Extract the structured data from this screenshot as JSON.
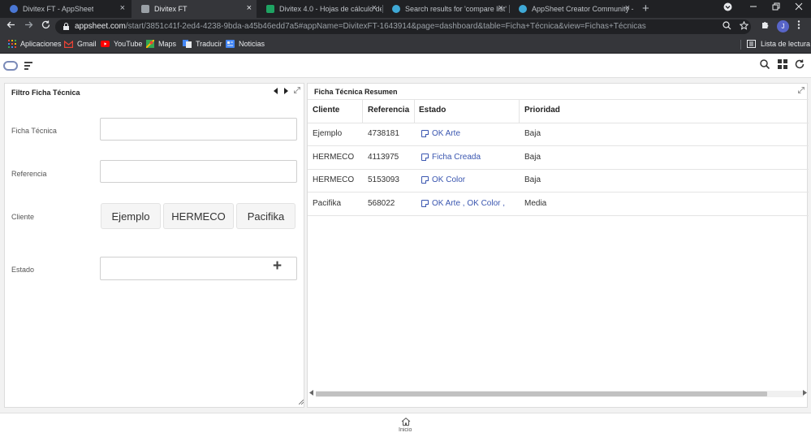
{
  "browser": {
    "tabs": [
      {
        "title": "Divitex FT - AppSheet",
        "active": false,
        "icon_color": "#4a77d4"
      },
      {
        "title": "Divitex FT",
        "active": true,
        "icon_color": "#9aa0a6"
      },
      {
        "title": "Divitex 4.0 - Hojas de cálculo de",
        "active": false,
        "icon_color": "#1ea362"
      },
      {
        "title": "Search results for 'compare list'",
        "active": false,
        "icon_color": "#3fa9d6"
      },
      {
        "title": "AppSheet Creator Community -",
        "active": false,
        "icon_color": "#3fa9d6"
      }
    ],
    "close_glyph": "×",
    "new_tab_glyph": "+",
    "url_host": "appsheet.com",
    "url_path": "/start/3851c41f-2ed4-4238-9bda-a45b46edd7a5#appName=DivitexFT-1643914&page=dashboard&table=Ficha+Técnica&view=Fichas+Técnicas",
    "profile_initial": "J",
    "bookmarks": [
      {
        "label": "Aplicaciones",
        "icon": "apps-grid-icon",
        "color": "#e8eaed"
      },
      {
        "label": "Gmail",
        "icon": "gmail-icon",
        "color": "#ea4335"
      },
      {
        "label": "YouTube",
        "icon": "youtube-icon",
        "color": "#ff0000"
      },
      {
        "label": "Maps",
        "icon": "maps-icon",
        "color": "#34a853"
      },
      {
        "label": "Traducir",
        "icon": "translate-icon",
        "color": "#4285f4"
      },
      {
        "label": "Noticias",
        "icon": "news-icon",
        "color": "#4285f4"
      }
    ],
    "reading_list": "Lista de lectura"
  },
  "filter_panel": {
    "title": "Filtro Ficha Técnica",
    "fields": {
      "ficha_label": "Ficha Técnica",
      "ficha_value": "",
      "referencia_label": "Referencia",
      "referencia_value": "",
      "cliente_label": "Cliente",
      "cliente_options": [
        "Ejemplo",
        "HERMECO",
        "Pacifika"
      ],
      "estado_label": "Estado",
      "estado_value": "",
      "add_glyph": "+"
    }
  },
  "summary_panel": {
    "title": "Ficha Técnica Resumen",
    "columns": [
      "Cliente",
      "Referencia",
      "Estado",
      "Prioridad"
    ],
    "rows": [
      {
        "cliente": "Ejemplo",
        "referencia": "4738181",
        "estado": "OK Arte",
        "prioridad": "Baja"
      },
      {
        "cliente": "HERMECO",
        "referencia": "4113975",
        "estado": "Ficha Creada",
        "prioridad": "Baja"
      },
      {
        "cliente": "HERMECO",
        "referencia": "5153093",
        "estado": "OK Color",
        "prioridad": "Baja"
      },
      {
        "cliente": "Pacifika",
        "referencia": "568022",
        "estado": "OK Arte , OK Color ,",
        "prioridad": "Media"
      }
    ]
  },
  "bottom_nav": {
    "home_label": "Inicio"
  },
  "colors": {
    "link": "#3a56b0",
    "chrome_dark": "#202124",
    "chrome_toolbar": "#35363a"
  }
}
